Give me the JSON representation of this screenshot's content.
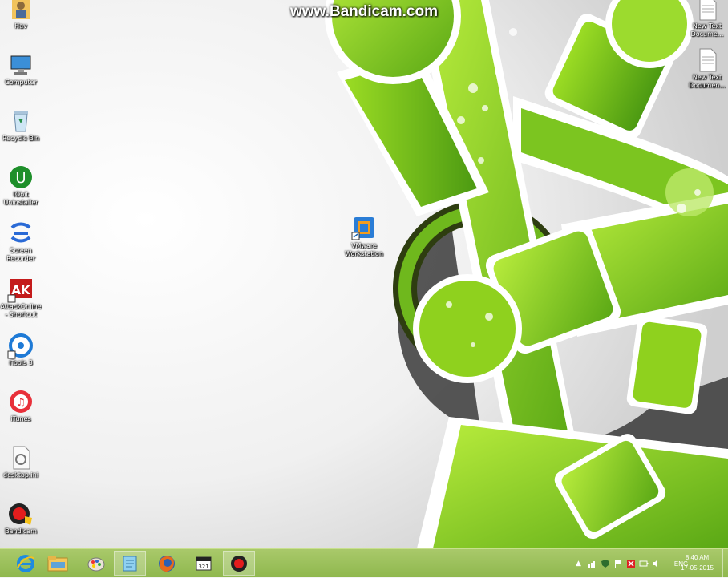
{
  "watermark": "www.Bandicam.com",
  "desktop_icons_left": [
    {
      "label": "Hav",
      "icon": "user-folder-icon"
    },
    {
      "label": "Computer",
      "icon": "computer-icon"
    },
    {
      "label": "Recycle Bin",
      "icon": "recycle-bin-icon"
    },
    {
      "label": "IObit Uninstaller",
      "icon": "iobit-uninstaller-icon"
    },
    {
      "label": "Screen Recorder",
      "icon": "screen-recorder-icon"
    },
    {
      "label": "AttackOnline - Shortcut",
      "icon": "attack-shortcut-icon"
    },
    {
      "label": "iTools 3",
      "icon": "itools-icon"
    },
    {
      "label": "iTunes",
      "icon": "itunes-icon"
    },
    {
      "label": "desktop.ini",
      "icon": "ini-file-icon"
    },
    {
      "label": "Bandicam",
      "icon": "bandicam-icon"
    }
  ],
  "desktop_icons_right": [
    {
      "label": "New Text Docume...",
      "icon": "text-document-icon"
    },
    {
      "label": "New Text Documen...",
      "icon": "text-document-icon"
    }
  ],
  "desktop_icon_center": {
    "label": "VMware Workstation",
    "icon": "vmware-icon"
  },
  "taskbar": {
    "pinned": [
      "internet-explorer-icon",
      "file-explorer-icon",
      "paint-icon",
      "notepad-icon",
      "firefox-icon",
      "media-player-classic-icon",
      "bandicam-record-icon"
    ],
    "language": "ENG",
    "time": "8:40 AM",
    "date": "17-05-2015"
  },
  "colors": {
    "taskbar": "#98bf58",
    "accent_green": "#8fd11e"
  }
}
